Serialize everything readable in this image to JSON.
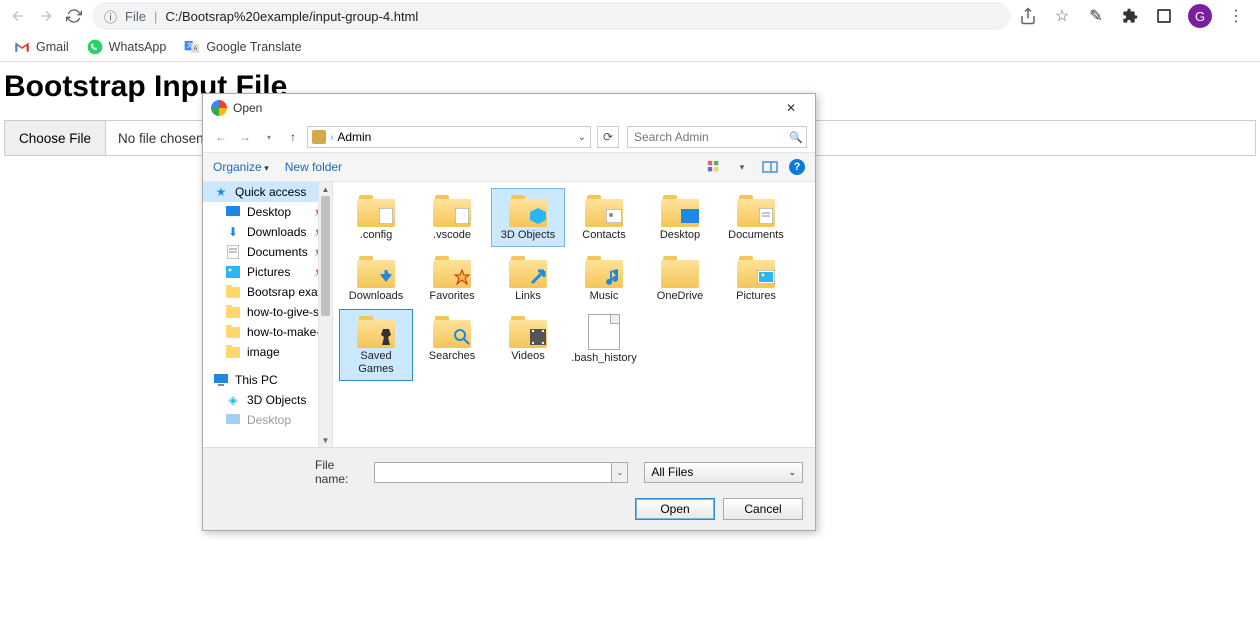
{
  "browser": {
    "address_prefix": "File",
    "address_sep": "|",
    "address": "C:/Bootsrap%20example/input-group-4.html",
    "profile_letter": "G"
  },
  "bookmarks": [
    {
      "id": "gmail",
      "label": "Gmail"
    },
    {
      "id": "whatsapp",
      "label": "WhatsApp"
    },
    {
      "id": "google-translate",
      "label": "Google Translate"
    }
  ],
  "page": {
    "title": "Bootstrap Input File",
    "choose_label": "Choose File",
    "no_file": "No file chosen"
  },
  "dialog": {
    "title": "Open",
    "path_current": "Admin",
    "search_placeholder": "Search Admin",
    "organize": "Organize",
    "new_folder": "New folder",
    "sidebar": {
      "quick_access": "Quick access",
      "items_pinned": [
        {
          "id": "desktop",
          "label": "Desktop",
          "icon": "desktop"
        },
        {
          "id": "downloads",
          "label": "Downloads",
          "icon": "downloads"
        },
        {
          "id": "documents",
          "label": "Documents",
          "icon": "documents"
        },
        {
          "id": "pictures",
          "label": "Pictures",
          "icon": "pictures"
        }
      ],
      "items_recent": [
        {
          "id": "bootsrap-example",
          "label": "Bootsrap examp"
        },
        {
          "id": "how-to-give-space",
          "label": "how-to-give-spa"
        },
        {
          "id": "how-to-make-table",
          "label": "how-to-make-ta"
        },
        {
          "id": "image",
          "label": "image"
        }
      ],
      "this_pc": "This PC",
      "pc_items": [
        {
          "id": "3d-objects",
          "label": "3D Objects"
        },
        {
          "id": "desktop2",
          "label": "Desktop"
        }
      ]
    },
    "files": [
      {
        "id": "config",
        "label": ".config",
        "type": "folder",
        "overlay": "doc"
      },
      {
        "id": "vscode",
        "label": ".vscode",
        "type": "folder",
        "overlay": "doc"
      },
      {
        "id": "3d-objects",
        "label": "3D Objects",
        "type": "folder",
        "overlay": "cube",
        "state": "highlighted"
      },
      {
        "id": "contacts",
        "label": "Contacts",
        "type": "folder",
        "overlay": "contact"
      },
      {
        "id": "desktop",
        "label": "Desktop",
        "type": "folder",
        "overlay": "screen"
      },
      {
        "id": "documents",
        "label": "Documents",
        "type": "folder",
        "overlay": "docs"
      },
      {
        "id": "downloads",
        "label": "Downloads",
        "type": "folder",
        "overlay": "download"
      },
      {
        "id": "favorites",
        "label": "Favorites",
        "type": "folder",
        "overlay": "star"
      },
      {
        "id": "links",
        "label": "Links",
        "type": "folder",
        "overlay": "link"
      },
      {
        "id": "music",
        "label": "Music",
        "type": "folder",
        "overlay": "music"
      },
      {
        "id": "onedrive",
        "label": "OneDrive",
        "type": "folder"
      },
      {
        "id": "pictures",
        "label": "Pictures",
        "type": "folder",
        "overlay": "photo"
      },
      {
        "id": "saved-games",
        "label": "Saved Games",
        "type": "folder",
        "overlay": "chess",
        "state": "selected"
      },
      {
        "id": "searches",
        "label": "Searches",
        "type": "folder",
        "overlay": "search"
      },
      {
        "id": "videos",
        "label": "Videos",
        "type": "folder",
        "overlay": "film"
      },
      {
        "id": "bash-history",
        "label": ".bash_history",
        "type": "file"
      }
    ],
    "filename_label": "File name:",
    "filename_value": "",
    "filter": "All Files",
    "open_btn": "Open",
    "cancel_btn": "Cancel"
  }
}
